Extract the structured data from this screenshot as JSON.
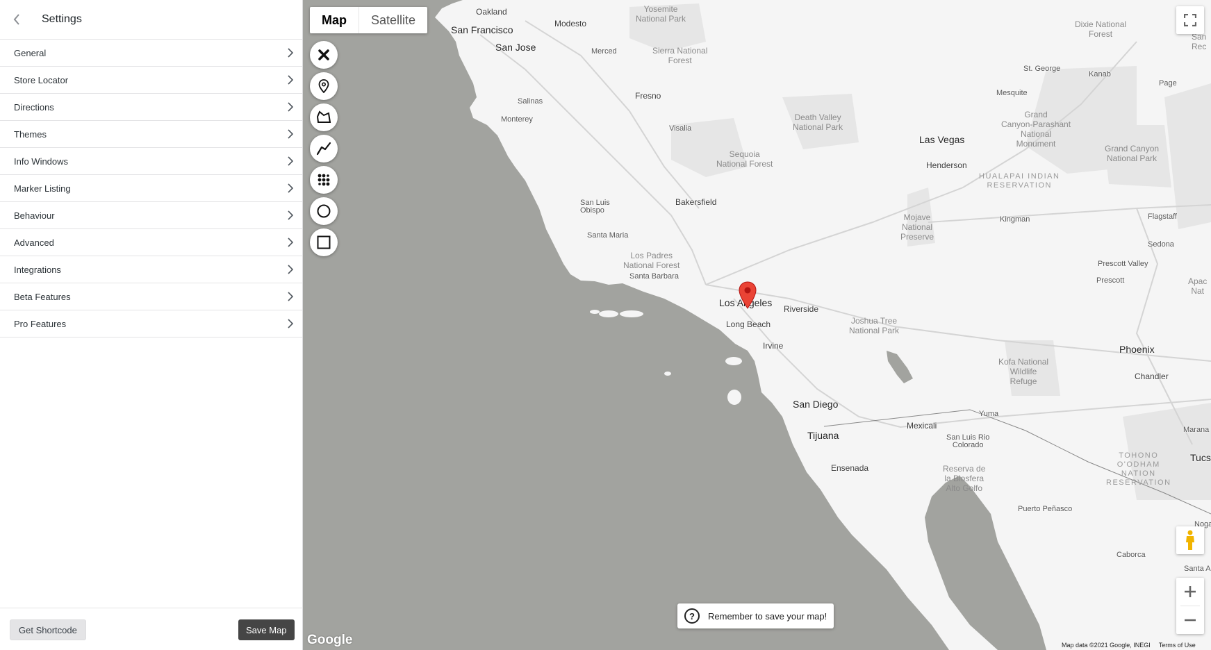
{
  "sidebar": {
    "title": "Settings",
    "items": [
      {
        "label": "General"
      },
      {
        "label": "Store Locator"
      },
      {
        "label": "Directions"
      },
      {
        "label": "Themes"
      },
      {
        "label": "Info Windows"
      },
      {
        "label": "Marker Listing"
      },
      {
        "label": "Behaviour"
      },
      {
        "label": "Advanced"
      },
      {
        "label": "Integrations"
      },
      {
        "label": "Beta Features"
      },
      {
        "label": "Pro Features"
      }
    ],
    "footer": {
      "shortcode_label": "Get Shortcode",
      "save_label": "Save Map"
    }
  },
  "map": {
    "map_type": {
      "map_label": "Map",
      "satellite_label": "Satellite",
      "selected": "Map"
    },
    "draw_tools": [
      {
        "icon": "close-icon"
      },
      {
        "icon": "marker-icon"
      },
      {
        "icon": "polygon-icon"
      },
      {
        "icon": "polyline-icon"
      },
      {
        "icon": "heatmap-icon"
      },
      {
        "icon": "circle-icon"
      },
      {
        "icon": "rectangle-icon"
      }
    ],
    "save_tip": "Remember to save your map!",
    "logo": "Google",
    "attribution": "Map data ©2021 Google, INEGI",
    "terms": "Terms of Use",
    "labels": {
      "oakland": "Oakland",
      "san_francisco": "San Francisco",
      "san_jose": "San Jose",
      "modesto": "Modesto",
      "merced": "Merced",
      "salinas": "Salinas",
      "monterey": "Monterey",
      "fresno": "Fresno",
      "visalia": "Visalia",
      "bakersfield": "Bakersfield",
      "san_luis_obispo": "San Luis\nObispo",
      "santa_maria": "Santa Maria",
      "santa_barbara": "Santa Barbara",
      "los_angeles": "Los Angeles",
      "long_beach": "Long Beach",
      "riverside": "Riverside",
      "irvine": "Irvine",
      "san_diego": "San Diego",
      "tijuana": "Tijuana",
      "ensenada": "Ensenada",
      "mexicali": "Mexicali",
      "yuma": "Yuma",
      "san_luis_rio_colorado": "San Luis Rio\nColorado",
      "las_vegas": "Las Vegas",
      "henderson": "Henderson",
      "st_george": "St. George",
      "mesquite": "Mesquite",
      "kanab": "Kanab",
      "page": "Page",
      "kingman": "Kingman",
      "flagstaff": "Flagstaff",
      "sedona": "Sedona",
      "prescott_valley": "Prescott Valley",
      "prescott": "Prescott",
      "phoenix": "Phoenix",
      "chandler": "Chandler",
      "marana": "Marana",
      "tucs": "Tucs",
      "puerto_penasco": "Puerto Peñasco",
      "caborca": "Caborca",
      "santa_ana": "Santa Ana",
      "nogales": "Noga",
      "apache": "Apac\nNat",
      "yosemite": "Yosemite\nNational Park",
      "sierra_nf": "Sierra National\nForest",
      "death_valley": "Death Valley\nNational Park",
      "sequoia": "Sequoia\nNational Forest",
      "los_padres": "Los Padres\nNational Forest",
      "mojave": "Mojave\nNational\nPreserve",
      "joshua_tree": "Joshua Tree\nNational Park",
      "kofa": "Kofa National\nWildlife\nRefuge",
      "grand_canyon_parashant": "Grand\nCanyon-Parashant\nNational\nMonument",
      "grand_canyon_np": "Grand Canyon\nNational Park",
      "dixie": "Dixie National\nForest",
      "hualapai": "HUALAPAI INDIAN\nRESERVATION",
      "tohono": "TOHONO\nO'ODHAM\nNATION\nRESERVATION",
      "reserva": "Reserva de\nla Biosfera\nAlto Golfo",
      "san_rec": "San\nRec"
    },
    "colors": {
      "water": "#a2a39f",
      "land": "#f5f5f5",
      "marker": "#ea4335"
    }
  }
}
